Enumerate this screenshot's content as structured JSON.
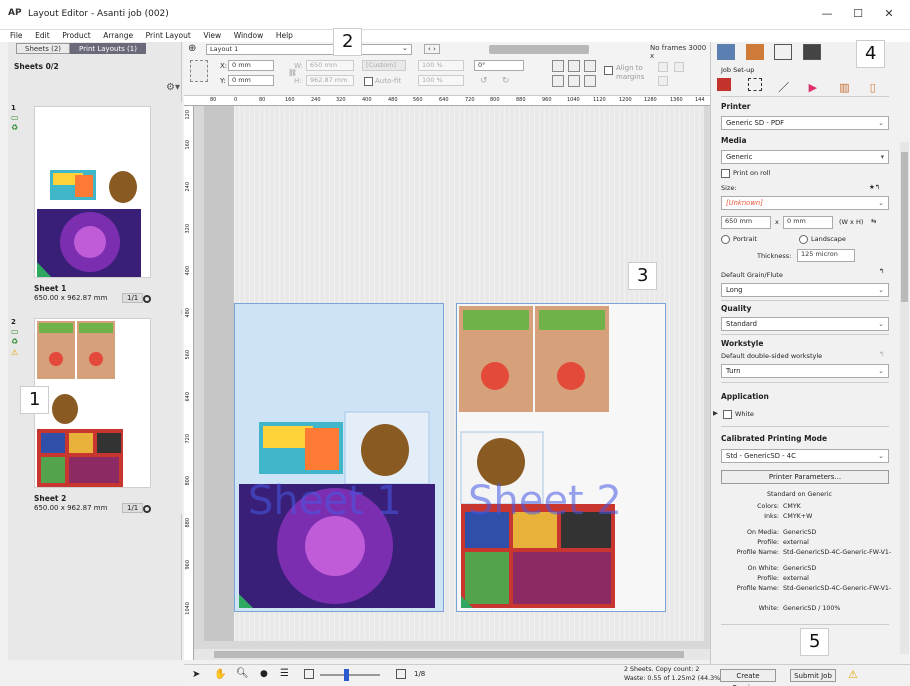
{
  "window": {
    "app_icon": "AP",
    "title": "Layout Editor - Asanti job (002)"
  },
  "menu": [
    "File",
    "Edit",
    "Product",
    "Arrange",
    "Print Layout",
    "View",
    "Window",
    "Help"
  ],
  "left_panel": {
    "tabs": [
      {
        "label": "Sheets (2)"
      },
      {
        "label": "Print Layouts (1)"
      }
    ],
    "sheets_title": "Sheets 0/2",
    "sheets": [
      {
        "number": "1",
        "name": "Sheet 1",
        "dims": "650.00 x 962.87 mm",
        "page": "1/1"
      },
      {
        "number": "2",
        "name": "Sheet 2",
        "dims": "650.00 x 962.87 mm",
        "page": "1/1"
      }
    ]
  },
  "toolbar": {
    "layout_name": "Layout 1",
    "frames_text": "No frames 3000 x",
    "x_value": "0 mm",
    "y_value": "0 mm",
    "w_value": "650 mm",
    "h_value": "962.87 mm",
    "custom_label": "[Custom]",
    "pct_w": "100 %",
    "pct_h": "100 %",
    "autofit_label": "Auto-fit",
    "rotation": "0°",
    "align_label": "Align to margins",
    "x_label": "X:",
    "y_label": "Y:",
    "w_label": "W:",
    "h_label": "H:"
  },
  "rulers": {
    "h_ticks": [
      "80",
      "0",
      "80",
      "160",
      "240",
      "320",
      "400",
      "480",
      "560",
      "640",
      "720",
      "800",
      "880",
      "960",
      "1040",
      "1120",
      "1200",
      "1280",
      "1360",
      "144"
    ],
    "v_ticks": [
      "120",
      "160",
      "240",
      "320",
      "400",
      "480",
      "560",
      "640",
      "720",
      "800",
      "880",
      "960",
      "1040"
    ]
  },
  "canvas": {
    "sheet1_label": "Sheet 1",
    "sheet2_label": "Sheet 2"
  },
  "callouts": [
    "1",
    "2",
    "3",
    "4",
    "5"
  ],
  "right_panel": {
    "subtab_label": "Job Set-up",
    "printer_label": "Printer",
    "printer_value": "Generic SD - PDF",
    "media_label": "Media",
    "media_value": "Generic",
    "print_on_roll": "Print on roll",
    "size_label": "Size:",
    "size_value": "[Unknown]",
    "width_value": "650 mm",
    "times": "x",
    "height_value": "0 mm",
    "wxh_label": "(W x H)",
    "portrait": "Portrait",
    "landscape": "Landscape",
    "thickness_label": "Thickness:",
    "thickness_value": "125 micron",
    "grain_label": "Default Grain/Flute",
    "grain_value": "Long",
    "quality_label": "Quality",
    "quality_value": "Standard",
    "workstyle_label": "Workstyle",
    "workstyle_sub": "Default double-sided workstyle",
    "workstyle_value": "Turn",
    "application_label": "Application",
    "white_label": "White",
    "calibrated_label": "Calibrated Printing Mode",
    "calibrated_value": "Std - GenericSD - 4C",
    "printer_params_button": "Printer Parameters...",
    "info_title": "Standard on Generic",
    "info": [
      {
        "k": "Colors:",
        "v": "CMYK"
      },
      {
        "k": "Inks:",
        "v": "CMYK+W"
      },
      {
        "k": "On Media:",
        "v": "GenericSD"
      },
      {
        "k": "Profile:",
        "v": "external"
      },
      {
        "k": "Profile Name:",
        "v": "Std-GenericSD-4C-Generic-FW-V1-"
      },
      {
        "k": "On White:",
        "v": "GenericSD"
      },
      {
        "k": "Profile:",
        "v": "external"
      },
      {
        "k": "Profile Name:",
        "v": "Std-GenericSD-4C-Generic-FW-V1-"
      },
      {
        "k": "White:",
        "v": "GenericSD / 100%"
      }
    ]
  },
  "bottom": {
    "zoom_text": "1/8",
    "status_line1": "2 Sheets. Copy count: 2",
    "status_line2": "Waste: 0.55 of 1.25m2 (44.3%)",
    "create_previews": "Create Previews",
    "submit_job": "Submit Job"
  },
  "colors": {
    "accent": "#6a6a7a",
    "sheet_label": "#4a5ae6",
    "warning": "#f2c200",
    "selection": "#cfe3f7"
  }
}
